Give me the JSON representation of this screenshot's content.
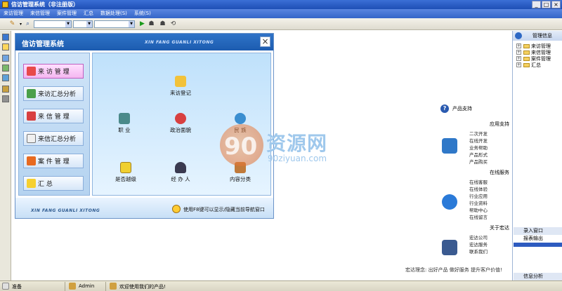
{
  "app": {
    "title": "信访管理系统（非注册版）"
  },
  "window_buttons": [
    "_",
    "□",
    "×"
  ],
  "menu": [
    "来访管理",
    "来信管理",
    "案件管理",
    "汇总",
    "数据处理(S)",
    "系统(S)"
  ],
  "nav": {
    "title": "信访管理系统",
    "pinyin": "XIN FANG GUANLI XITONG",
    "buttons": [
      {
        "label": "来 访 管 理"
      },
      {
        "label": "来访汇总分析"
      },
      {
        "label": "来 信 管 理"
      },
      {
        "label": "来信汇总分析"
      },
      {
        "label": "案 件 管 理"
      },
      {
        "label": "汇        总"
      }
    ],
    "items": {
      "visit_register": "来访登记",
      "occupation": "职    业",
      "political": "政治面貌",
      "ethnicity": "民    族",
      "repeat": "是否越级",
      "handler": "经 办 人",
      "category": "内容分类"
    },
    "footer_pinyin": "XIN FANG GUANLI XITONG",
    "footer_tip": "使用F8键可以显示/隐藏当前导航窗口"
  },
  "watermark": {
    "logo": "90",
    "text": "资源网",
    "url": "90ziyuan.com"
  },
  "product": {
    "title": "产品支持",
    "sections": [
      {
        "name": "应用支持",
        "links": [
          "二次开发",
          "在线开发",
          "业务帮助",
          "产品形式",
          "产品购买"
        ]
      },
      {
        "name": "在线服务",
        "links": [
          "在线客服",
          "在线体验",
          "行业应用",
          "行业资料",
          "帮助中心",
          "在线留言"
        ]
      },
      {
        "name": "关于宏达",
        "links": [
          "宏达公司",
          "宏达服务",
          "联系我们"
        ]
      }
    ],
    "slogan": "宏达理念: 出好产品  做好服务  提升客户价值!"
  },
  "right_panel": {
    "title": "管理信息",
    "tree": [
      "来访管理",
      "来信管理",
      "案件管理",
      "汇总"
    ],
    "buttons": [
      "录入窗口",
      "报表输出",
      "信息分析"
    ]
  },
  "status": {
    "ready": "准备",
    "user": "Admin",
    "welcome": "欢迎使用我们的产品!"
  }
}
